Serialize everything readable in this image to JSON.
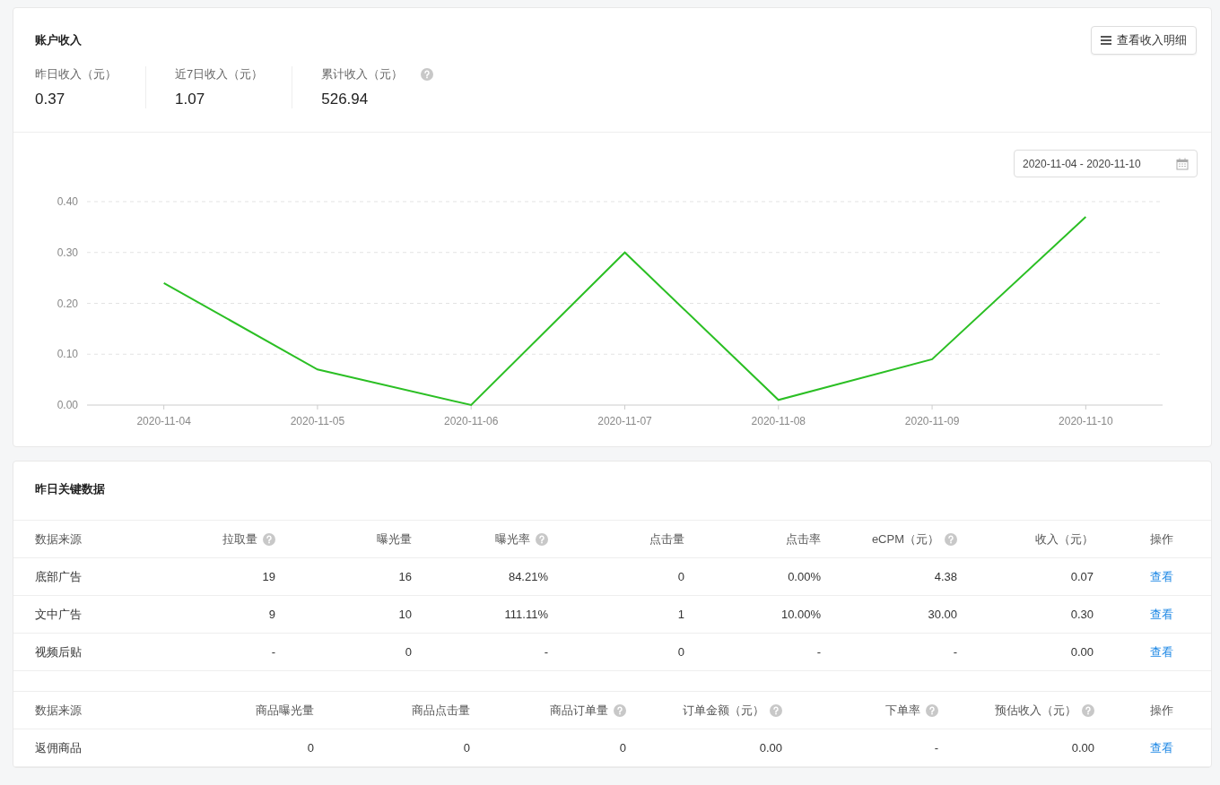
{
  "income_card": {
    "title": "账户收入",
    "detail_button": "查看收入明细",
    "stats": [
      {
        "label": "昨日收入（元）",
        "value": "0.37",
        "help": false
      },
      {
        "label": "近7日收入（元）",
        "value": "1.07",
        "help": false
      },
      {
        "label": "累计收入（元）",
        "value": "526.94",
        "help": true
      }
    ],
    "date_range": "2020-11-04 - 2020-11-10",
    "chart_data": {
      "type": "line",
      "categories": [
        "2020-11-04",
        "2020-11-05",
        "2020-11-06",
        "2020-11-07",
        "2020-11-08",
        "2020-11-09",
        "2020-11-10"
      ],
      "series": [
        {
          "color": "#2bbf24",
          "values": [
            0.24,
            0.07,
            0.0,
            0.3,
            0.01,
            0.09,
            0.37
          ]
        }
      ],
      "grid": true,
      "ylim": [
        0,
        0.4
      ],
      "yticks": [
        {
          "value": 0,
          "label": "0.00"
        },
        {
          "value": 0.1,
          "label": "0.10"
        },
        {
          "value": 0.2,
          "label": "0.20"
        },
        {
          "value": 0.3,
          "label": "0.30"
        },
        {
          "value": 0.4,
          "label": "0.40"
        }
      ]
    }
  },
  "key_data_card": {
    "title": "昨日关键数据",
    "tables": [
      {
        "columns": [
          {
            "label": "数据来源",
            "help": false
          },
          {
            "label": "拉取量",
            "help": true
          },
          {
            "label": "曝光量",
            "help": false
          },
          {
            "label": "曝光率",
            "help": true
          },
          {
            "label": "点击量",
            "help": false
          },
          {
            "label": "点击率",
            "help": false
          },
          {
            "label": "eCPM（元）",
            "help": true
          },
          {
            "label": "收入（元）",
            "help": false
          },
          {
            "label": "操作",
            "help": false
          }
        ],
        "rows": [
          {
            "cells": [
              "底部广告",
              "19",
              "16",
              "84.21%",
              "0",
              "0.00%",
              "4.38",
              "0.07"
            ],
            "action": "查看"
          },
          {
            "cells": [
              "文中广告",
              "9",
              "10",
              "111.11%",
              "1",
              "10.00%",
              "30.00",
              "0.30"
            ],
            "action": "查看"
          },
          {
            "cells": [
              "视频后贴",
              "-",
              "0",
              "-",
              "0",
              "-",
              "-",
              "0.00"
            ],
            "action": "查看"
          }
        ]
      },
      {
        "columns": [
          {
            "label": "数据来源",
            "help": false
          },
          {
            "label": "商品曝光量",
            "help": false
          },
          {
            "label": "商品点击量",
            "help": false
          },
          {
            "label": "商品订单量",
            "help": true
          },
          {
            "label": "订单金额（元）",
            "help": true
          },
          {
            "label": "下单率",
            "help": true
          },
          {
            "label": "预估收入（元）",
            "help": true
          },
          {
            "label": "操作",
            "help": false
          }
        ],
        "rows": [
          {
            "cells": [
              "返佣商品",
              "0",
              "0",
              "0",
              "0.00",
              "-",
              "0.00"
            ],
            "action": "查看"
          }
        ]
      }
    ]
  }
}
